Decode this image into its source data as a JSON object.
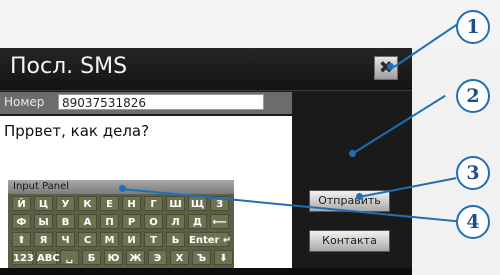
{
  "window": {
    "title": "Посл. SMS",
    "close_label": "✖"
  },
  "form": {
    "number_label": "Номер",
    "number_value": "89037531826",
    "message_text": "Пррвет, как дела?"
  },
  "buttons": {
    "send_label": "Отправить",
    "contacts_label": "Контакта"
  },
  "input_panel": {
    "title": "Input Panel",
    "rows": [
      [
        "Й",
        "Ц",
        "У",
        "К",
        "Е",
        "Н",
        "Г",
        "Ш",
        "Щ",
        "З"
      ],
      [
        "Ф",
        "Ы",
        "В",
        "А",
        "П",
        "Р",
        "О",
        "Л",
        "Д",
        "⟵"
      ],
      [
        "⬆",
        "Я",
        "Ч",
        "С",
        "М",
        "И",
        "Т",
        "Ь",
        "Enter ↵"
      ],
      [
        "123",
        "ABC",
        "␣",
        "Б",
        "Ю",
        "Ж",
        "Э",
        "Х",
        "Ъ",
        "⬇"
      ]
    ]
  },
  "callouts": [
    "1",
    "2",
    "3",
    "4"
  ]
}
